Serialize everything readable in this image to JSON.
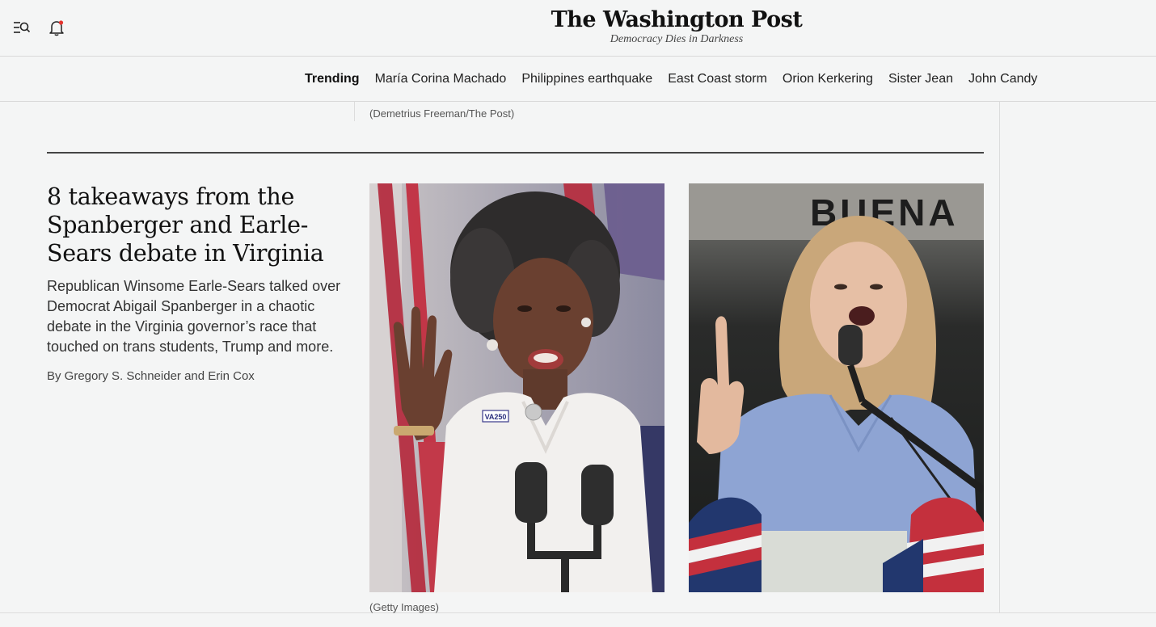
{
  "header": {
    "logo": "The Washington Post",
    "tagline": "Democracy Dies in Darkness",
    "icons": {
      "menu": "menu-search-icon",
      "notifications": "bell-icon"
    }
  },
  "trending": {
    "label": "Trending",
    "links": [
      "María Corina Machado",
      "Philippines earthquake",
      "East Coast storm",
      "Orion Kerkering",
      "Sister Jean",
      "John Candy"
    ]
  },
  "top_photo_caption": "(Demetrius Freeman/The Post)",
  "story": {
    "headline": "8 takeaways from the Spanberger and Earle-Sears debate in Virginia",
    "dek": "Republican Winsome Earle-Sears talked over Democrat Abigail Spanberger in a chaotic debate in the Virginia governor’s race that touched on trans students, Trump and more.",
    "byline": "By Gregory S. Schneider and Erin Cox",
    "photo_caption": "(Getty Images)",
    "pin_text": "VA250",
    "banner_text": "BUENA"
  }
}
